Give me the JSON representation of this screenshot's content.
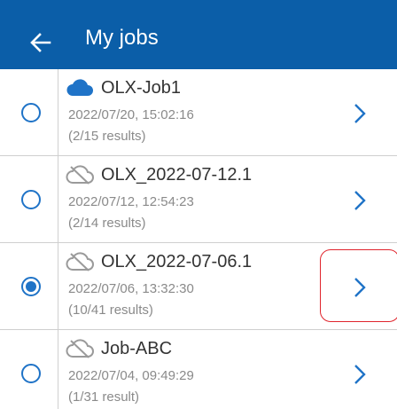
{
  "header": {
    "title": "My jobs",
    "back_icon": "arrow-left-icon",
    "background": "#0b5ea8"
  },
  "jobs": [
    {
      "name": "OLX-Job1",
      "date": "2022/07/20, 15:02:16",
      "results": "(2/15 results)",
      "cloud": "cloud-synced",
      "selected": false
    },
    {
      "name": "OLX_2022-07-12.1",
      "date": "2022/07/12, 12:54:23",
      "results": "(2/14 results)",
      "cloud": "cloud-off",
      "selected": false
    },
    {
      "name": "OLX_2022-07-06.1",
      "date": "2022/07/06, 13:32:30",
      "results": "(10/41 results)",
      "cloud": "cloud-off",
      "selected": true
    },
    {
      "name": "Job-ABC",
      "date": "2022/07/04, 09:49:29",
      "results": "(1/31 result)",
      "cloud": "cloud-off",
      "selected": false
    }
  ],
  "colors": {
    "accent": "#1f73c7",
    "annotation": "#e0242c"
  }
}
